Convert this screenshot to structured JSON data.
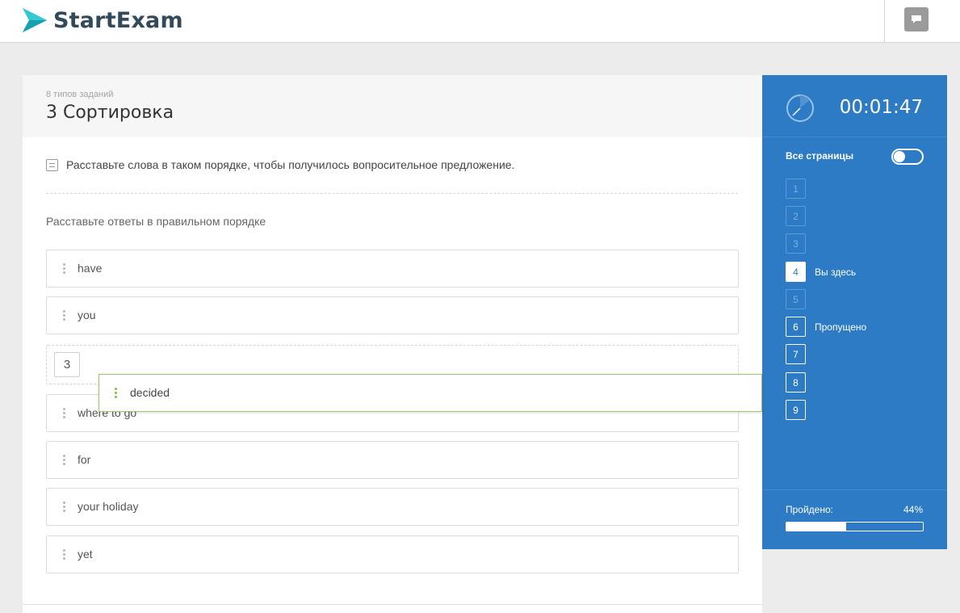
{
  "header": {
    "brand": "StartExam",
    "logo_icon": "play-arrow-logo-icon",
    "chat_icon": "chat-bubble-icon"
  },
  "task": {
    "breadcrumb": "8 типов заданий",
    "title": "3 Сортировка",
    "instruction": "Расставьте слова в таком порядке, чтобы получилось вопросительное предложение.",
    "hint": "Расставьте ответы в правильном порядке",
    "items": [
      {
        "label": "have"
      },
      {
        "label": "you"
      },
      {
        "label": "where to go"
      },
      {
        "label": "for"
      },
      {
        "label": "your holiday"
      },
      {
        "label": "yet"
      }
    ],
    "placeholder_number": "3",
    "dragged_item": "decided"
  },
  "panel": {
    "timer": "00:01:47",
    "all_pages_label": "Все страницы",
    "all_pages_on": false,
    "pages": [
      {
        "num": "1",
        "state": "unvisited",
        "note": ""
      },
      {
        "num": "2",
        "state": "unvisited",
        "note": ""
      },
      {
        "num": "3",
        "state": "unvisited",
        "note": ""
      },
      {
        "num": "4",
        "state": "current",
        "note": "Вы здесь"
      },
      {
        "num": "5",
        "state": "unvisited",
        "note": ""
      },
      {
        "num": "6",
        "state": "visited",
        "note": "Пропущено"
      },
      {
        "num": "7",
        "state": "visited",
        "note": ""
      },
      {
        "num": "8",
        "state": "visited",
        "note": ""
      },
      {
        "num": "9",
        "state": "visited",
        "note": ""
      }
    ],
    "progress_label": "Пройдено:",
    "progress_text": "44%",
    "progress_fraction": 0.44
  },
  "colors": {
    "panel_blue": "#2c7bc4",
    "brand_teal": "#1fb5c4",
    "drag_green": "#8bc34a"
  }
}
